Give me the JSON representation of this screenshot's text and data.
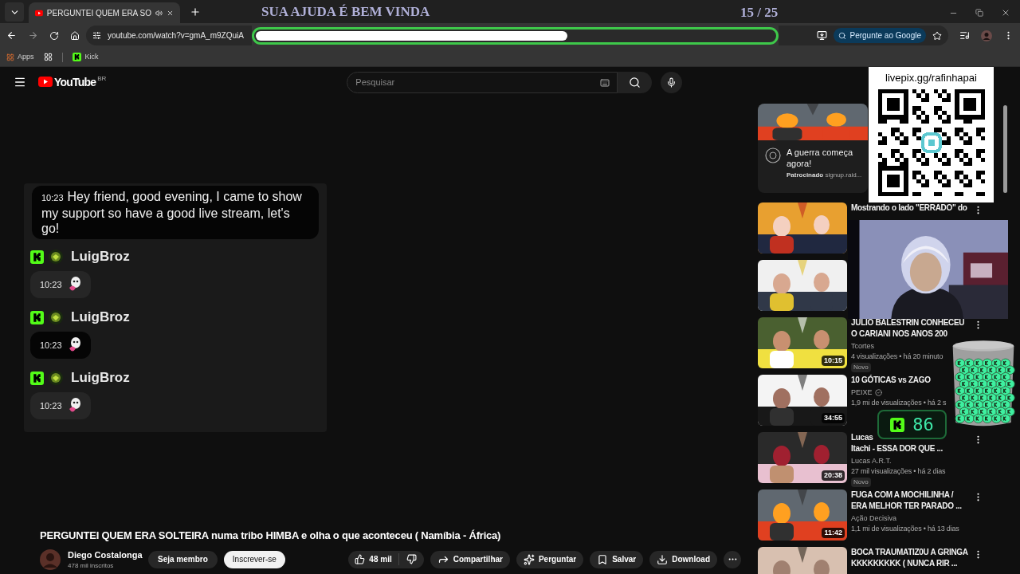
{
  "browser": {
    "tabs": [
      {
        "title": "PERGUNTEI QUEM ERA SO",
        "selected": true,
        "audio": true
      }
    ],
    "url": "youtube.com/watch?v=gmA_m9ZQuiA",
    "ask_google": "Pergunte ao Google",
    "bookmarks": [
      {
        "label": "Apps",
        "kind": "apps"
      },
      {
        "label": "Kick",
        "kind": "kick"
      }
    ]
  },
  "goal": {
    "title": "SUA AJUDA É BEM VINDA",
    "count": "15 / 25",
    "level": 0.6
  },
  "youtube": {
    "logo_text": "YouTube",
    "region": "BR",
    "search_placeholder": "Pesquisar"
  },
  "chat": {
    "messages": [
      {
        "kind": "text",
        "time": "10:23",
        "text": "Hey friend, good evening, I came to show my support so have a good live stream, let's go!",
        "highlighted": true
      },
      {
        "kind": "emote",
        "user": "LuigBroz",
        "time": "10:23",
        "highlighted": false
      },
      {
        "kind": "emote",
        "user": "LuigBroz",
        "time": "10:23",
        "highlighted": true
      },
      {
        "kind": "emote",
        "user": "LuigBroz",
        "time": "10:23",
        "highlighted": false
      }
    ]
  },
  "video": {
    "title": "PERGUNTEI QUEM ERA SOLTEIRA numa tribo HIMBA e olha o que aconteceu ( Namíbia - África)",
    "channel": "Diego Costalonga",
    "subscribers": "478 mil inscritos",
    "join": "Seja membro",
    "subscribe": "Inscrever-se",
    "likes": "48 mil",
    "actions": [
      {
        "label": "Compartilhar",
        "kind": "share"
      },
      {
        "label": "Perguntar",
        "kind": "ask"
      },
      {
        "label": "Salvar",
        "kind": "save"
      },
      {
        "label": "Download",
        "kind": "download"
      }
    ]
  },
  "sidebar": {
    "ad": {
      "title": "A guerra começa agora!",
      "label": "Patrocinado",
      "domain": "signup.raid..."
    },
    "videos": [
      {
        "kind": "video",
        "title_lines": [
          "Mostrando o lado \"ERRADO\" do"
        ],
        "menu": true
      },
      {
        "kind": "video"
      },
      {
        "kind": "video",
        "title_lines": [
          "JULIO BALESTRIN CONHECEU",
          "O CARIANI NOS ANOS 200"
        ],
        "channel": "Tcortes",
        "meta": "4 visualizações • há 20 minuto",
        "badge": "Novo",
        "duration": "10:15",
        "menu": true
      },
      {
        "kind": "video",
        "title_lines": [
          "10 GÓTICAS vs ZAGO"
        ],
        "channel": "PEIXE",
        "verified": true,
        "meta": "1,9 mi de visualizações • há 2 s",
        "duration": "34:55"
      },
      {
        "kind": "video",
        "title_lines": [
          "Lucas",
          "Itachi - ESSA DOR QUE ..."
        ],
        "channel": "Lucas A.R.T.",
        "meta": "27 mil visualizações • há 2 dias",
        "badge": "Novo",
        "duration": "20:38",
        "menu": true
      },
      {
        "kind": "video",
        "title_lines": [
          "FUGA COM A MOCHILINHA /",
          "ERA MELHOR TER PARADO ..."
        ],
        "channel": "Ação Decisiva",
        "meta": "1,1 mi de visualizações • há 13 dias",
        "duration": "11:42",
        "menu": true
      },
      {
        "kind": "video",
        "title_lines": [
          "BOCA TRAUMATIZ0U A GRINGA",
          "KKKKKKKKK ( NUNCA RIR ..."
        ],
        "menu": true
      }
    ]
  },
  "donation": {
    "url": "livepix.gg/rafinhapai"
  },
  "kick_counter": {
    "count": "86"
  }
}
